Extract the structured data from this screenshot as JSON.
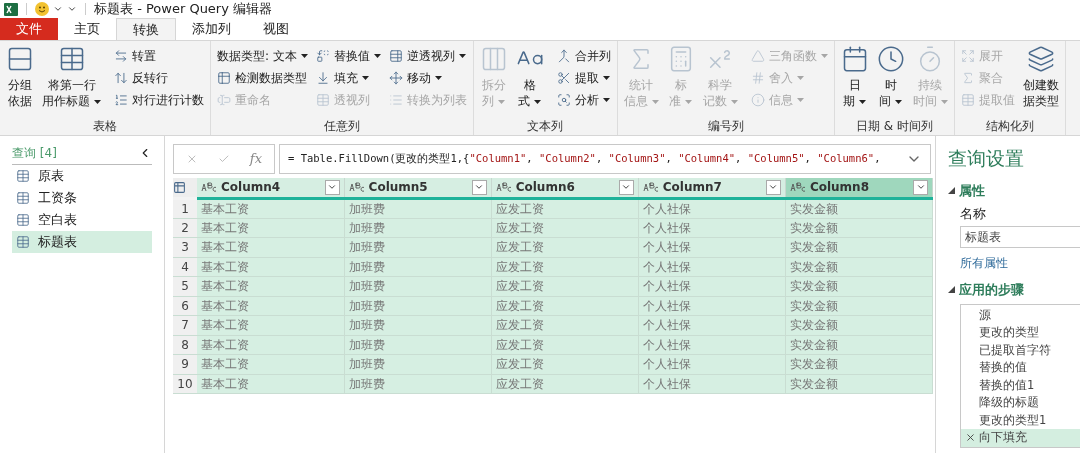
{
  "window": {
    "title": "标题表 - Power Query 编辑器"
  },
  "tabs": [
    {
      "label": "文件",
      "kind": "file",
      "selected": false
    },
    {
      "label": "主页",
      "kind": "tab",
      "selected": false
    },
    {
      "label": "转换",
      "kind": "tab",
      "selected": true
    },
    {
      "label": "添加列",
      "kind": "tab",
      "selected": false
    },
    {
      "label": "视图",
      "kind": "tab",
      "selected": false
    }
  ],
  "ribbon": {
    "groups": [
      {
        "label": "表格",
        "items": [
          {
            "kind": "large",
            "lines": [
              "分组",
              "依据"
            ],
            "dropdown": false,
            "disabled": false
          },
          {
            "kind": "large",
            "lines": [
              "将第一行",
              "用作标题"
            ],
            "dropdown": true,
            "disabled": false
          },
          {
            "kind": "small",
            "lines": [
              "转置"
            ],
            "dropdown": false,
            "disabled": false
          },
          {
            "kind": "small",
            "lines": [
              "反转行"
            ],
            "dropdown": false,
            "disabled": false
          },
          {
            "kind": "small",
            "lines": [
              "对行进行计数"
            ],
            "dropdown": false,
            "disabled": false
          }
        ]
      },
      {
        "label": "任意列",
        "items": [
          {
            "kind": "small",
            "lines": [
              "数据类型: 文本"
            ],
            "dropdown": true,
            "disabled": false
          },
          {
            "kind": "small",
            "lines": [
              "检测数据类型"
            ],
            "dropdown": false,
            "disabled": false
          },
          {
            "kind": "small",
            "lines": [
              "重命名"
            ],
            "dropdown": false,
            "disabled": true
          },
          {
            "kind": "small",
            "lines": [
              "替换值"
            ],
            "dropdown": true,
            "disabled": false
          },
          {
            "kind": "small",
            "lines": [
              "填充"
            ],
            "dropdown": true,
            "disabled": false
          },
          {
            "kind": "small",
            "lines": [
              "透视列"
            ],
            "dropdown": false,
            "disabled": true
          },
          {
            "kind": "small",
            "lines": [
              "逆透视列"
            ],
            "dropdown": true,
            "disabled": false
          },
          {
            "kind": "small",
            "lines": [
              "移动"
            ],
            "dropdown": true,
            "disabled": false
          },
          {
            "kind": "small",
            "lines": [
              "转换为列表"
            ],
            "dropdown": false,
            "disabled": true
          }
        ]
      },
      {
        "label": "文本列",
        "items": [
          {
            "kind": "large",
            "lines": [
              "拆分",
              "列"
            ],
            "dropdown": true,
            "disabled": true
          },
          {
            "kind": "large",
            "lines": [
              "格",
              "式"
            ],
            "dropdown": true,
            "disabled": false
          },
          {
            "kind": "small",
            "lines": [
              "合并列"
            ],
            "dropdown": false,
            "disabled": false
          },
          {
            "kind": "small",
            "lines": [
              "提取"
            ],
            "dropdown": true,
            "disabled": false
          },
          {
            "kind": "small",
            "lines": [
              "分析"
            ],
            "dropdown": true,
            "disabled": false
          }
        ]
      },
      {
        "label": "编号列",
        "items": [
          {
            "kind": "large",
            "lines": [
              "统计",
              "信息"
            ],
            "dropdown": true,
            "disabled": true
          },
          {
            "kind": "large",
            "lines": [
              "标",
              "准"
            ],
            "dropdown": true,
            "disabled": true
          },
          {
            "kind": "large",
            "lines": [
              "科学",
              "记数"
            ],
            "dropdown": true,
            "disabled": true
          },
          {
            "kind": "small",
            "lines": [
              "三角函数"
            ],
            "dropdown": true,
            "disabled": true
          },
          {
            "kind": "small",
            "lines": [
              "舍入"
            ],
            "dropdown": true,
            "disabled": true
          },
          {
            "kind": "small",
            "lines": [
              "信息"
            ],
            "dropdown": true,
            "disabled": true
          }
        ]
      },
      {
        "label": "日期 & 时间列",
        "items": [
          {
            "kind": "large",
            "lines": [
              "日",
              "期"
            ],
            "dropdown": true,
            "disabled": false
          },
          {
            "kind": "large",
            "lines": [
              "时",
              "间"
            ],
            "dropdown": true,
            "disabled": false
          },
          {
            "kind": "large",
            "lines": [
              "持续",
              "时间"
            ],
            "dropdown": true,
            "disabled": true
          }
        ]
      },
      {
        "label": "结构化列",
        "items": [
          {
            "kind": "small",
            "lines": [
              "展开"
            ],
            "dropdown": false,
            "disabled": true
          },
          {
            "kind": "small",
            "lines": [
              "聚合"
            ],
            "dropdown": false,
            "disabled": true
          },
          {
            "kind": "small",
            "lines": [
              "提取值"
            ],
            "dropdown": false,
            "disabled": true
          },
          {
            "kind": "large",
            "lines": [
              "创建数",
              "据类型"
            ],
            "dropdown": false,
            "disabled": false
          }
        ]
      }
    ]
  },
  "queries": {
    "title": "查询 [4]",
    "items": [
      {
        "label": "原表",
        "selected": false
      },
      {
        "label": "工资条",
        "selected": false
      },
      {
        "label": "空白表",
        "selected": false
      },
      {
        "label": "标题表",
        "selected": true
      }
    ]
  },
  "formula_bar": {
    "fx": "fx",
    "tokens": [
      {
        "kind": "plain",
        "text": "= Table.FillDown(更改的类型1,{"
      },
      {
        "kind": "string",
        "text": "\"Column1\""
      },
      {
        "kind": "plain",
        "text": ", "
      },
      {
        "kind": "string",
        "text": "\"Column2\""
      },
      {
        "kind": "plain",
        "text": ", "
      },
      {
        "kind": "string",
        "text": "\"Column3\""
      },
      {
        "kind": "plain",
        "text": ", "
      },
      {
        "kind": "string",
        "text": "\"Column4\""
      },
      {
        "kind": "plain",
        "text": ", "
      },
      {
        "kind": "string",
        "text": "\"Column5\""
      },
      {
        "kind": "plain",
        "text": ", "
      },
      {
        "kind": "string",
        "text": "\"Column6\""
      },
      {
        "kind": "plain",
        "text": ","
      }
    ]
  },
  "table": {
    "columns": [
      {
        "name": "Column4",
        "selected": false
      },
      {
        "name": "Column5",
        "selected": false
      },
      {
        "name": "Column6",
        "selected": false
      },
      {
        "name": "Column7",
        "selected": false
      },
      {
        "name": "Column8",
        "selected": true
      }
    ],
    "rows": [
      {
        "num": "1",
        "cells": [
          "基本工资",
          "加班费",
          "应发工资",
          "个人社保",
          "实发金额"
        ]
      },
      {
        "num": "2",
        "cells": [
          "基本工资",
          "加班费",
          "应发工资",
          "个人社保",
          "实发金额"
        ]
      },
      {
        "num": "3",
        "cells": [
          "基本工资",
          "加班费",
          "应发工资",
          "个人社保",
          "实发金额"
        ]
      },
      {
        "num": "4",
        "cells": [
          "基本工资",
          "加班费",
          "应发工资",
          "个人社保",
          "实发金额"
        ]
      },
      {
        "num": "5",
        "cells": [
          "基本工资",
          "加班费",
          "应发工资",
          "个人社保",
          "实发金额"
        ]
      },
      {
        "num": "6",
        "cells": [
          "基本工资",
          "加班费",
          "应发工资",
          "个人社保",
          "实发金额"
        ]
      },
      {
        "num": "7",
        "cells": [
          "基本工资",
          "加班费",
          "应发工资",
          "个人社保",
          "实发金额"
        ]
      },
      {
        "num": "8",
        "cells": [
          "基本工资",
          "加班费",
          "应发工资",
          "个人社保",
          "实发金额"
        ]
      },
      {
        "num": "9",
        "cells": [
          "基本工资",
          "加班费",
          "应发工资",
          "个人社保",
          "实发金额"
        ]
      },
      {
        "num": "10",
        "cells": [
          "基本工资",
          "加班费",
          "应发工资",
          "个人社保",
          "实发金额"
        ]
      }
    ]
  },
  "settings": {
    "title": "查询设置",
    "properties": {
      "heading": "属性",
      "expanded": true,
      "name_label": "名称",
      "name_value": "标题表",
      "link": "所有属性"
    },
    "steps": {
      "heading": "应用的步骤",
      "expanded": true,
      "items": [
        {
          "label": "源",
          "selected": false
        },
        {
          "label": "更改的类型",
          "selected": false
        },
        {
          "label": "已提取首字符",
          "selected": false
        },
        {
          "label": "替换的值",
          "selected": false
        },
        {
          "label": "替换的值1",
          "selected": false
        },
        {
          "label": "降级的标题",
          "selected": false
        },
        {
          "label": "更改的类型1",
          "selected": false
        },
        {
          "label": "向下填充",
          "selected": true
        }
      ]
    }
  }
}
